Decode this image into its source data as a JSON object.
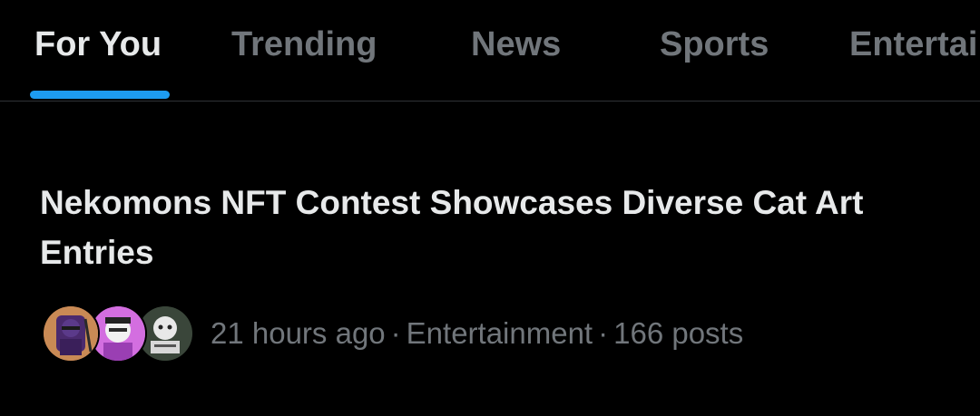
{
  "tabs": [
    {
      "label": "For You",
      "active": true
    },
    {
      "label": "Trending",
      "active": false
    },
    {
      "label": "News",
      "active": false
    },
    {
      "label": "Sports",
      "active": false
    },
    {
      "label": "Entertainment",
      "active": false
    }
  ],
  "trend": {
    "title": "Nekomons NFT Contest Showcases Diverse Cat Art Entries",
    "time": "21 hours ago",
    "category": "Entertainment",
    "posts": "166 posts",
    "separator": "·",
    "avatars": [
      "avatar-1",
      "avatar-2",
      "avatar-3"
    ]
  },
  "colors": {
    "background": "#000000",
    "text_primary": "#e7e9ea",
    "text_secondary": "#71767b",
    "accent": "#1d9bf0",
    "divider": "#2f3336"
  }
}
